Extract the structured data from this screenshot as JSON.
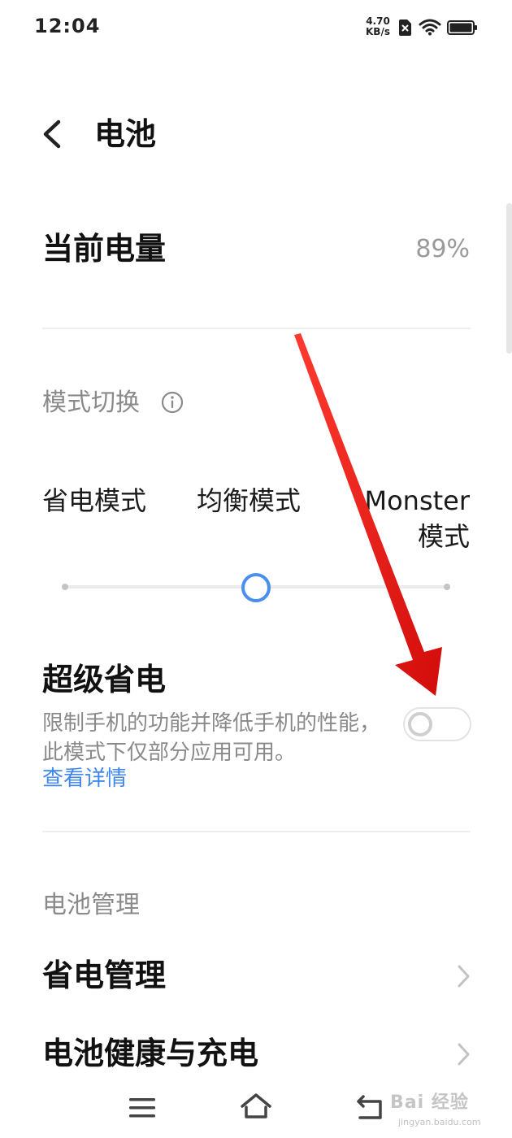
{
  "status_bar": {
    "time": "12:04",
    "net_speed_value": "4.70",
    "net_speed_unit": "KB/s",
    "sim_icon": "no-sim-icon",
    "wifi_icon": "wifi-icon",
    "battery_icon": "battery-icon"
  },
  "header": {
    "back_icon": "chevron-left-icon",
    "title": "电池"
  },
  "current_battery": {
    "label": "当前电量",
    "value": "89%"
  },
  "mode_switch": {
    "title": "模式切换",
    "info_icon": "info-icon",
    "modes": [
      "省电模式",
      "均衡模式",
      "Monster\n模式"
    ],
    "selected_index": 1,
    "slider_position_fraction": 0.5,
    "accent_color": "#4a8ff0"
  },
  "super_save": {
    "title": "超级省电",
    "description": "限制手机的功能并降低手机的性能，此模式下仅部分应用可用。",
    "details_link": "查看详情",
    "enabled": false,
    "link_color": "#3f87f0"
  },
  "battery_management": {
    "title": "电池管理",
    "items": [
      {
        "label": "省电管理",
        "icon": "chevron-right-icon"
      },
      {
        "label": "电池健康与充电",
        "icon": "chevron-right-icon"
      }
    ]
  },
  "nav_bar": {
    "menu_icon": "menu-icon",
    "home_icon": "home-icon",
    "back_icon": "back-icon"
  },
  "annotation": {
    "arrow_color": "#e8140f"
  },
  "watermark": {
    "main": "Bai 经验",
    "sub": "jingyan.baidu.com"
  }
}
